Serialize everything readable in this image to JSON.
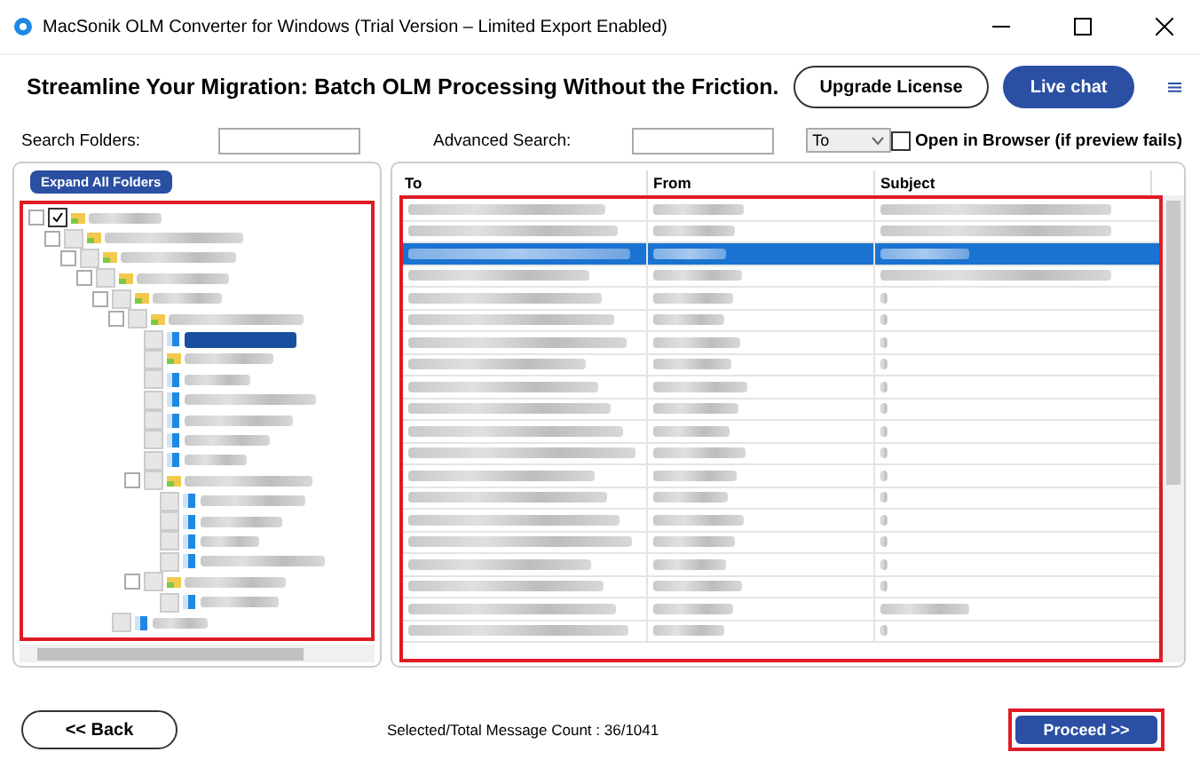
{
  "window": {
    "title": "MacSonik OLM Converter for Windows (Trial Version – Limited Export Enabled)"
  },
  "header": {
    "heading": "Streamline Your Migration: Batch OLM Processing Without the Friction.",
    "buttons": [
      "Upgrade License",
      "Live chat"
    ],
    "menu_glyph": "≡"
  },
  "search": {
    "folders_label": "Search Folders:",
    "advanced_label": "Advanced Search:",
    "field_option": "To",
    "open_in_browser": {
      "label": "Open in Browser (if preview fails)",
      "checked": false
    }
  },
  "tree": {
    "expand_button": "Expand All Folders",
    "nodes": [
      {
        "kind": "yellow",
        "checked": true,
        "selected": false,
        "children": [
          {
            "kind": "yellow",
            "checked": false,
            "selected": false,
            "children": [
              {
                "kind": "yellow",
                "checked": false,
                "selected": false,
                "children": [
                  {
                    "kind": "yellow",
                    "checked": false,
                    "selected": false,
                    "children": [
                      {
                        "kind": "yellow",
                        "checked": false,
                        "selected": false,
                        "children": [
                          {
                            "kind": "yellow",
                            "checked": false,
                            "selected": false,
                            "children": [
                              {
                                "kind": "blue",
                                "checked": false,
                                "selected": true
                              },
                              {
                                "kind": "yellow",
                                "checked": false,
                                "selected": false
                              },
                              {
                                "kind": "blue",
                                "checked": false,
                                "selected": false
                              },
                              {
                                "kind": "blue",
                                "checked": false,
                                "selected": false
                              },
                              {
                                "kind": "blue",
                                "checked": false,
                                "selected": false
                              },
                              {
                                "kind": "blue",
                                "checked": false,
                                "selected": false
                              },
                              {
                                "kind": "blue",
                                "checked": false,
                                "selected": false
                              },
                              {
                                "kind": "yellow",
                                "checked": false,
                                "selected": false,
                                "children": [
                                  {
                                    "kind": "blue",
                                    "checked": false,
                                    "selected": false
                                  },
                                  {
                                    "kind": "blue",
                                    "checked": false,
                                    "selected": false
                                  },
                                  {
                                    "kind": "blue",
                                    "checked": false,
                                    "selected": false
                                  },
                                  {
                                    "kind": "blue",
                                    "checked": false,
                                    "selected": false
                                  }
                                ]
                              },
                              {
                                "kind": "yellow",
                                "checked": false,
                                "selected": false,
                                "children": [
                                  {
                                    "kind": "blue",
                                    "checked": false,
                                    "selected": false
                                  }
                                ]
                              }
                            ]
                          }
                        ]
                      },
                      {
                        "kind": "blue",
                        "checked": false,
                        "selected": false
                      }
                    ]
                  }
                ]
              }
            ]
          }
        ]
      }
    ]
  },
  "table": {
    "columns": [
      "To",
      "From",
      "Subject"
    ],
    "rows": [
      {
        "selected": false,
        "kind": "long"
      },
      {
        "selected": false,
        "kind": "long"
      },
      {
        "selected": true,
        "kind": "short"
      },
      {
        "selected": false,
        "kind": "long"
      },
      {
        "selected": false,
        "kind": "mark"
      },
      {
        "selected": false,
        "kind": "mark"
      },
      {
        "selected": false,
        "kind": "mark"
      },
      {
        "selected": false,
        "kind": "mark"
      },
      {
        "selected": false,
        "kind": "mark"
      },
      {
        "selected": false,
        "kind": "mark"
      },
      {
        "selected": false,
        "kind": "mark"
      },
      {
        "selected": false,
        "kind": "mark"
      },
      {
        "selected": false,
        "kind": "mark"
      },
      {
        "selected": false,
        "kind": "mark"
      },
      {
        "selected": false,
        "kind": "mark"
      },
      {
        "selected": false,
        "kind": "mark"
      },
      {
        "selected": false,
        "kind": "mark"
      },
      {
        "selected": false,
        "kind": "mark"
      },
      {
        "selected": false,
        "kind": "short"
      },
      {
        "selected": false,
        "kind": "mark"
      }
    ]
  },
  "footer": {
    "back": "<< Back",
    "count": "Selected/Total Message Count : 36/1041",
    "proceed": "Proceed >>"
  }
}
